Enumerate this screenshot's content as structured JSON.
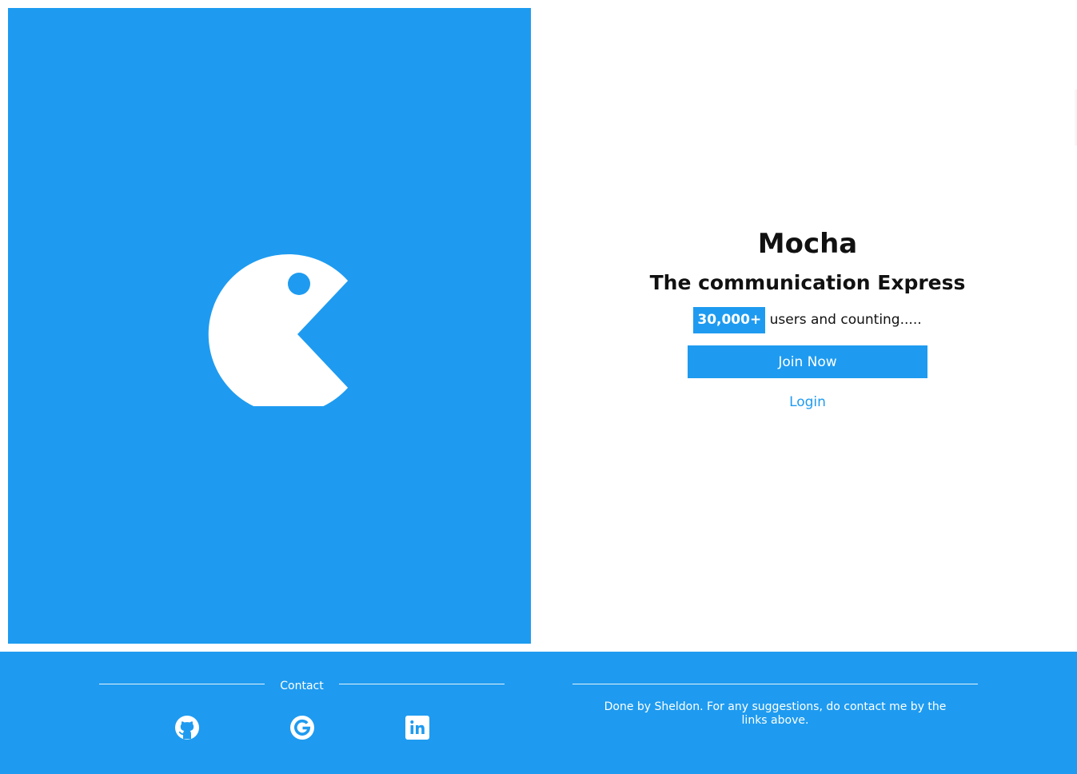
{
  "brand": {
    "title": "Mocha",
    "tagline": "The communication Express",
    "logo_icon": "chomp-logo-icon",
    "accent_color": "#1e9bf0"
  },
  "stats": {
    "count": "30,000+",
    "suffix": "users and counting....."
  },
  "actions": {
    "join_label": "Join Now",
    "login_label": "Login"
  },
  "footer": {
    "contact_heading": "Contact",
    "social": [
      {
        "icon": "github-icon",
        "label": "GitHub"
      },
      {
        "icon": "google-icon",
        "label": "Google"
      },
      {
        "icon": "linkedin-icon",
        "label": "LinkedIn"
      }
    ],
    "credit": "Done by Sheldon. For any suggestions, do contact me by the links above."
  }
}
